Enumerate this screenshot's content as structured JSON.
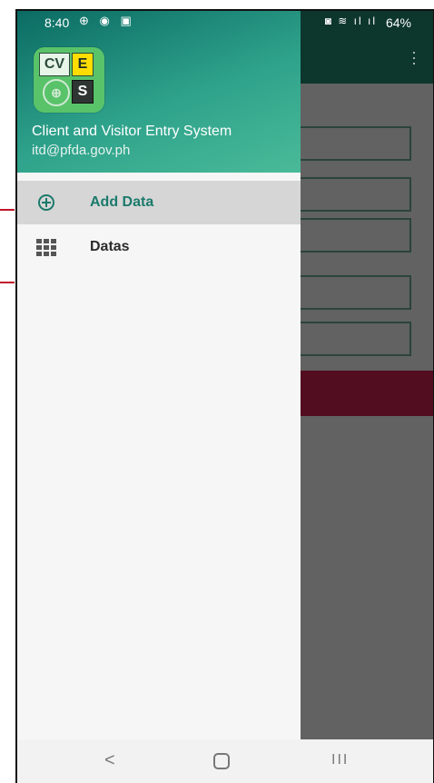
{
  "status_bar": {
    "time": "8:40",
    "battery": "64%"
  },
  "drawer": {
    "app_name": "Client and Visitor Entry System",
    "email": "itd@pfda.gov.ph",
    "logo": {
      "cv": "CV",
      "e": "E",
      "s": "S"
    },
    "items": [
      {
        "label": "Add Data",
        "icon": "add-circle-icon",
        "active": true
      },
      {
        "label": "Datas",
        "icon": "grid-icon",
        "active": false
      }
    ]
  },
  "colors": {
    "header": "#2ea28b",
    "active_item_text": "#1b7a6c",
    "bg_button": "#5a0f24"
  }
}
